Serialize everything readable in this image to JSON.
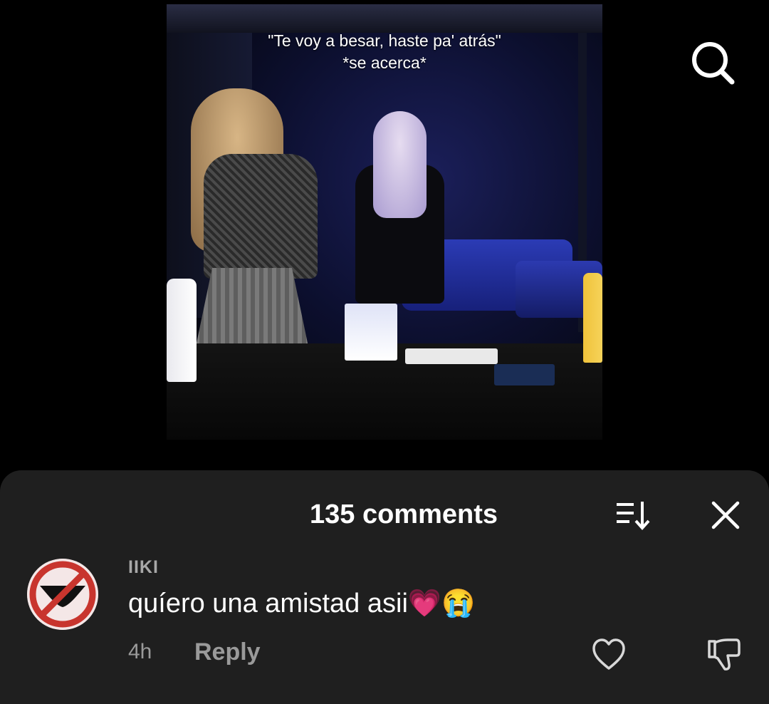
{
  "video": {
    "caption_line1": "\"Te voy a besar, haste pa' atrás\"",
    "caption_line2": "*se acerca*"
  },
  "header": {
    "search_icon": "search-icon"
  },
  "comments_panel": {
    "title": "135 comments",
    "sort_icon": "sort-icon",
    "close_icon": "close-icon",
    "comments": [
      {
        "username": "IIKI",
        "text": "quíero una amistad asii💗😭",
        "time": "4h",
        "reply_label": "Reply",
        "like_icon": "heart-icon",
        "dislike_icon": "thumbs-down-icon",
        "avatar_icon": "no-underwear-sign-icon"
      }
    ]
  },
  "colors": {
    "background": "#000000",
    "sheet": "#1f1f1f",
    "muted_text": "#9a9a9a",
    "avatar_red": "#c8352e"
  }
}
